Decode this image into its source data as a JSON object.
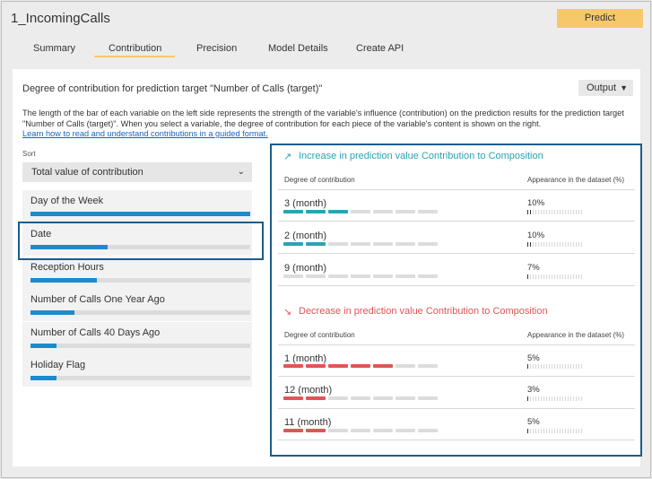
{
  "app": {
    "title": "1_IncomingCalls",
    "predict_label": "Predict"
  },
  "tabs": [
    {
      "label": "Summary",
      "active": false
    },
    {
      "label": "Contribution",
      "active": true
    },
    {
      "label": "Precision",
      "active": false
    },
    {
      "label": "Model Details",
      "active": false
    },
    {
      "label": "Create API",
      "active": false
    }
  ],
  "heading": "Degree of contribution for prediction target \"Number of Calls (target)\"",
  "output_label": "Output",
  "description": "The length of the bar of each variable on the left side represents the strength of the variable's influence (contribution) on the prediction results for the prediction target \"Number of Calls (target)\". When you select a variable, the degree of contribution for each piece of the variable's content is shown on the right.",
  "learn_link": "Learn how to read and understand contributions in a guided format.",
  "sort": {
    "label": "Sort",
    "selected": "Total value of contribution"
  },
  "variables": [
    {
      "label": "Day of the Week",
      "contribution": 1.0,
      "selected": false
    },
    {
      "label": "Date",
      "contribution": 0.35,
      "selected": true
    },
    {
      "label": "Reception Hours",
      "contribution": 0.3,
      "selected": false
    },
    {
      "label": "Number of Calls One Year Ago",
      "contribution": 0.2,
      "selected": false
    },
    {
      "label": "Number of Calls 40 Days Ago",
      "contribution": 0.12,
      "selected": false
    },
    {
      "label": "Holiday Flag",
      "contribution": 0.12,
      "selected": false
    }
  ],
  "increase": {
    "title": "Increase in prediction value Contribution to Composition",
    "color": "#2aa3b5",
    "icon": "trending-up-icon",
    "col_contribution": "Degree of contribution",
    "col_appearance": "Appearance in the dataset (%)",
    "rows": [
      {
        "label": "3 (month)",
        "level": 3,
        "percent": "10%",
        "percent_value": 10
      },
      {
        "label": "2 (month)",
        "level": 2,
        "percent": "10%",
        "percent_value": 10
      },
      {
        "label": "9 (month)",
        "level": 0,
        "percent": "7%",
        "percent_value": 7
      }
    ]
  },
  "decrease": {
    "title": "Decrease in prediction value Contribution to Composition",
    "color": "#e05555",
    "icon": "trending-down-icon",
    "col_contribution": "Degree of contribution",
    "col_appearance": "Appearance in the dataset (%)",
    "rows": [
      {
        "label": "1 (month)",
        "level": 5,
        "percent": "5%",
        "percent_value": 5
      },
      {
        "label": "12 (month)",
        "level": 2,
        "percent": "3%",
        "percent_value": 3
      },
      {
        "label": "11 (month)",
        "level": 2,
        "percent": "5%",
        "percent_value": 5
      }
    ]
  },
  "colors": {
    "accent": "#f5c96b",
    "bar": "#1a8ccd",
    "highlight_border": "#1d5c8a",
    "empty_segment": "#dcdcdc"
  }
}
